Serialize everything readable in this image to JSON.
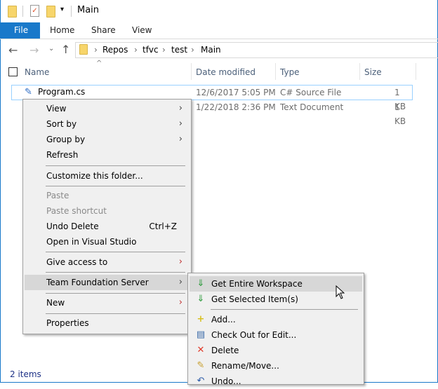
{
  "title": "Main",
  "ribbon": {
    "tabs": [
      "File",
      "Home",
      "Share",
      "View"
    ]
  },
  "address": {
    "crumbs": [
      "Repos",
      "tfvc",
      "test",
      "Main"
    ]
  },
  "columns": {
    "name": "Name",
    "date": "Date modified",
    "type": "Type",
    "size": "Size"
  },
  "files": [
    {
      "name": "Program.cs",
      "date": "12/6/2017 5:05 PM",
      "type": "C# Source File",
      "size": "1 KB"
    },
    {
      "name": "",
      "date": "1/22/2018 2:36 PM",
      "type": "Text Document",
      "size": "1 KB"
    }
  ],
  "status": "2 items",
  "context_menu": {
    "view": "View",
    "sort_by": "Sort by",
    "group_by": "Group by",
    "refresh": "Refresh",
    "customize": "Customize this folder...",
    "paste": "Paste",
    "paste_shortcut": "Paste shortcut",
    "undo_delete": "Undo Delete",
    "undo_shortcut": "Ctrl+Z",
    "open_vs": "Open in Visual Studio",
    "give_access": "Give access to",
    "tfs": "Team Foundation Server",
    "new": "New",
    "properties": "Properties"
  },
  "tfs_menu": {
    "get_workspace": "Get Entire Workspace",
    "get_selected": "Get Selected Item(s)",
    "add": "Add...",
    "checkout": "Check Out for Edit...",
    "delete": "Delete",
    "rename": "Rename/Move...",
    "undo": "Undo..."
  }
}
